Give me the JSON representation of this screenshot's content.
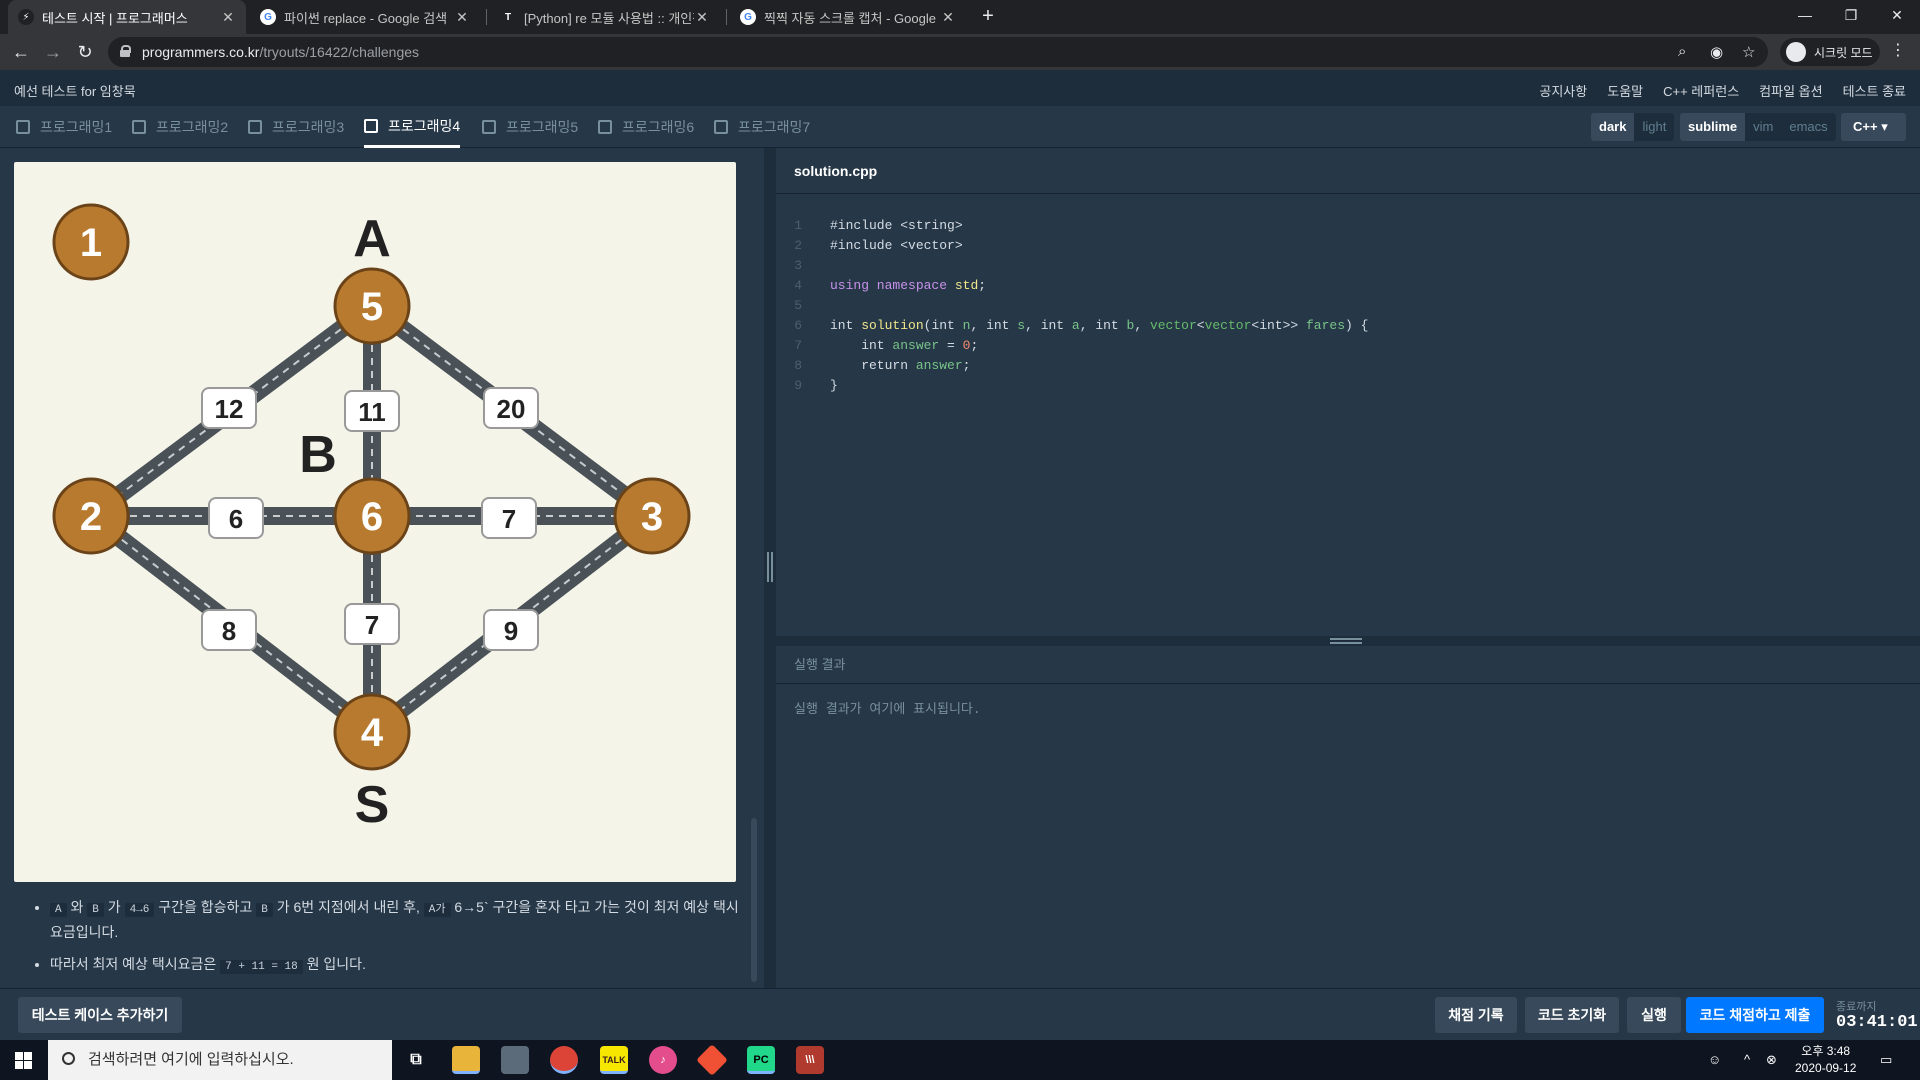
{
  "browser": {
    "tabs": [
      {
        "title": "테스트 시작 | 프로그래머스",
        "active": true
      },
      {
        "title": "파이썬 replace - Google 검색",
        "active": false
      },
      {
        "title": "[Python] re 모듈 사용법 :: 개인적",
        "active": false
      },
      {
        "title": "찍찍 자동 스크롤 캡처 - Google",
        "active": false
      }
    ],
    "url_host": "programmers.co.kr",
    "url_path": "/tryouts/16422/challenges",
    "incognito_label": "시크릿 모드"
  },
  "header": {
    "test_title": "예선 테스트 for 임창묵",
    "links": [
      "공지사항",
      "도움말",
      "C++ 레퍼런스",
      "컴파일 옵션",
      "테스트 종료"
    ]
  },
  "problem_tabs": [
    {
      "label": "프로그래밍1",
      "active": false
    },
    {
      "label": "프로그래밍2",
      "active": false
    },
    {
      "label": "프로그래밍3",
      "active": false
    },
    {
      "label": "프로그래밍4",
      "active": true
    },
    {
      "label": "프로그래밍5",
      "active": false
    },
    {
      "label": "프로그래밍6",
      "active": false
    },
    {
      "label": "프로그래밍7",
      "active": false
    }
  ],
  "editor_options": {
    "themes": [
      {
        "label": "dark",
        "on": true
      },
      {
        "label": "light",
        "on": false
      }
    ],
    "keymaps": [
      {
        "label": "sublime",
        "on": true
      },
      {
        "label": "vim",
        "on": false
      },
      {
        "label": "emacs",
        "on": false
      }
    ],
    "language": "C++"
  },
  "diagram": {
    "corner_label": "1",
    "nodes": {
      "a": "5",
      "b": "6",
      "s": "4",
      "left": "2",
      "right": "3"
    },
    "letters": {
      "a": "A",
      "b": "B",
      "s": "S"
    },
    "weights": {
      "a_left": "12",
      "a_b": "11",
      "a_right": "20",
      "left_b": "6",
      "b_right": "7",
      "left_s": "8",
      "b_s": "7",
      "right_s": "9"
    }
  },
  "description": {
    "line1": {
      "c1": "A",
      "t1": " 와 ",
      "c2": "B",
      "t2": " 가 ",
      "c3": "4→6",
      "t3": " 구간을 합승하고 ",
      "c4": "B",
      "t4": " 가 6번 지점에서 내린 후, ",
      "c5": "A가",
      "t5": " 6→5` 구간을 혼자 타고 가는 것이 최저 예상 택시요금입니다."
    },
    "line2": {
      "t1": "따라서 최저 예상 택시요금은 ",
      "c1": "7 + 11 = 18",
      "t2": " 원 입니다."
    }
  },
  "editor": {
    "filename": "solution.cpp",
    "line_numbers": [
      "1",
      "2",
      "3",
      "4",
      "5",
      "6",
      "7",
      "8",
      "9"
    ],
    "line1": "#include <string>",
    "line2": "#include <vector>",
    "line4": {
      "kw": "using namespace",
      "ns": "std",
      "end": ";"
    },
    "line6": {
      "t1": "int ",
      "fn": "solution",
      "t2": "(int ",
      "p1": "n",
      "t3": ", int ",
      "p2": "s",
      "t4": ", int ",
      "p3": "a",
      "t5": ", int ",
      "p4": "b",
      "t6": ", ",
      "tp1": "vector",
      "t7": "<",
      "tp2": "vector",
      "t8": "<int>> ",
      "p5": "fares",
      "t9": ") {"
    },
    "line7": {
      "t1": "    int ",
      "var": "answer",
      "t2": " = ",
      "num": "0",
      "t3": ";"
    },
    "line8": {
      "t1": "    return ",
      "var": "answer",
      "t2": ";"
    },
    "line9": "}"
  },
  "output": {
    "title": "실행 결과",
    "placeholder": "실행 결과가 여기에 표시됩니다."
  },
  "footer": {
    "add_testcase": "테스트 케이스 추가하기",
    "history": "채점 기록",
    "reset": "코드 초기화",
    "run": "실행",
    "submit": "코드 채점하고 제출",
    "timer_label": "종료까지",
    "timer": "03:41:01"
  },
  "taskbar": {
    "search_placeholder": "검색하려면 여기에 입력하십시오.",
    "time": "오후 3:48",
    "date": "2020-09-12"
  },
  "colors": {
    "accent": "#0078ff",
    "node": "#b87a2e",
    "road": "#4a5258"
  }
}
